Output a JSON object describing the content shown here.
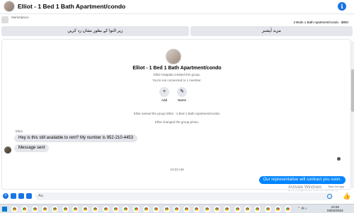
{
  "header": {
    "title": "Elliot - 1 Bed 1 Bath Apartment/condo",
    "info_icon": "i"
  },
  "marketplace": {
    "label": "Marketplace",
    "listing": "2 Beds 1 Bath Apartment/condo - $850"
  },
  "actions": {
    "left_label": "زیر التوا کے بطور نشان زد کریں",
    "right_label": "مزید آپشنز"
  },
  "group": {
    "title": "Elliot - 1 Bed 1 Bath Apartment/condo",
    "created": "Elliot Haapala created this group.",
    "connected": "You're not connected to 1 member.",
    "add_label": "Add",
    "name_label": "Name",
    "add_icon": "+",
    "name_icon": "✎"
  },
  "events": {
    "named": "Elliot named the group Elliot - 1 Bed 1 Bath Apartment/condo.",
    "photo": "Elliot changed the group photo."
  },
  "messages": {
    "sender": "Elliot",
    "msg1": "Hey is this still available to rent? My number is 952-210-4453",
    "msg2": "Message sent",
    "timestamp": "10:23 AM",
    "outgoing": "Our representative will contract you soon.",
    "sent_status": "Sent 1m ago"
  },
  "watermark": {
    "line1": "Activate Windows",
    "line2": "Go to Settings to activate Windows."
  },
  "composer": {
    "placeholder": "Aa"
  },
  "taskbar": {
    "time": "10:25",
    "date": "03/02/2023",
    "tray": "⌃ ✉ ♪"
  }
}
